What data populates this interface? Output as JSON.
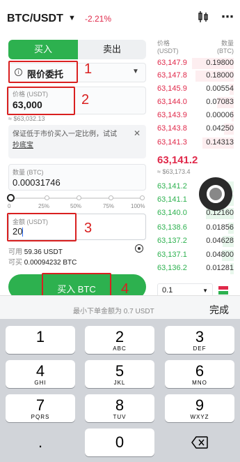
{
  "header": {
    "pair": "BTC/USDT",
    "change": "-2.21%"
  },
  "tabs": {
    "buy": "买入",
    "sell": "卖出"
  },
  "order_type": {
    "label": "限价委托"
  },
  "price": {
    "label": "价格 (USDT)",
    "value": "63,000",
    "approx": "≈ $63,032.13"
  },
  "notice": {
    "text": "保证低于市价买入一定比例，试试",
    "link": "抄底宝"
  },
  "amount": {
    "label": "数量 (BTC)",
    "value": "0.00031746"
  },
  "slider": {
    "ticks": [
      "0",
      "25%",
      "50%",
      "75%",
      "100%"
    ],
    "level": 0
  },
  "total": {
    "label": "金额 (USDT)",
    "value": "20"
  },
  "available": {
    "label": "可用",
    "value": "59.36 USDT"
  },
  "can_buy": {
    "label": "可买",
    "value": "0.00094232 BTC"
  },
  "buy_button": {
    "label": "买入 BTC"
  },
  "annotations": [
    "1",
    "2",
    "3",
    "4"
  ],
  "orderbook": {
    "price_header": "价格",
    "price_unit": "(USDT)",
    "qty_header": "数量",
    "qty_unit": "(BTC)",
    "asks": [
      {
        "price": "63,147.9",
        "qty": "0.19800"
      },
      {
        "price": "63,147.8",
        "qty": "0.18000"
      },
      {
        "price": "63,145.9",
        "qty": "0.00554"
      },
      {
        "price": "63,144.0",
        "qty": "0.07083"
      },
      {
        "price": "63,143.9",
        "qty": "0.00006"
      },
      {
        "price": "63,143.8",
        "qty": "0.04250"
      },
      {
        "price": "63,141.3",
        "qty": "0.14313"
      }
    ],
    "last_price": "63,141.2",
    "last_price_usd": "≈ $63,173.4",
    "bids": [
      {
        "price": "63,141.2",
        "qty": ""
      },
      {
        "price": "63,141.1",
        "qty": ""
      },
      {
        "price": "63,140.0",
        "qty": "0.12160"
      },
      {
        "price": "63,138.6",
        "qty": "0.01856"
      },
      {
        "price": "63,137.2",
        "qty": "0.04628"
      },
      {
        "price": "63,137.1",
        "qty": "0.04800"
      },
      {
        "price": "63,136.2",
        "qty": "0.01281"
      }
    ],
    "depth": "0.1"
  },
  "keyboard": {
    "hint": "最小下单金额为 0.7 USDT",
    "done": "完成",
    "keys": [
      {
        "digit": "1",
        "letters": ""
      },
      {
        "digit": "2",
        "letters": "ABC"
      },
      {
        "digit": "3",
        "letters": "DEF"
      },
      {
        "digit": "4",
        "letters": "GHI"
      },
      {
        "digit": "5",
        "letters": "JKL"
      },
      {
        "digit": "6",
        "letters": "MNO"
      },
      {
        "digit": "7",
        "letters": "PQRS"
      },
      {
        "digit": "8",
        "letters": "TUV"
      },
      {
        "digit": "9",
        "letters": "WXYZ"
      },
      {
        "digit": ".",
        "letters": ""
      },
      {
        "digit": "0",
        "letters": ""
      }
    ]
  },
  "colors": {
    "buy": "#2db14f",
    "sell": "#e0294a",
    "annotation": "#d92020"
  }
}
